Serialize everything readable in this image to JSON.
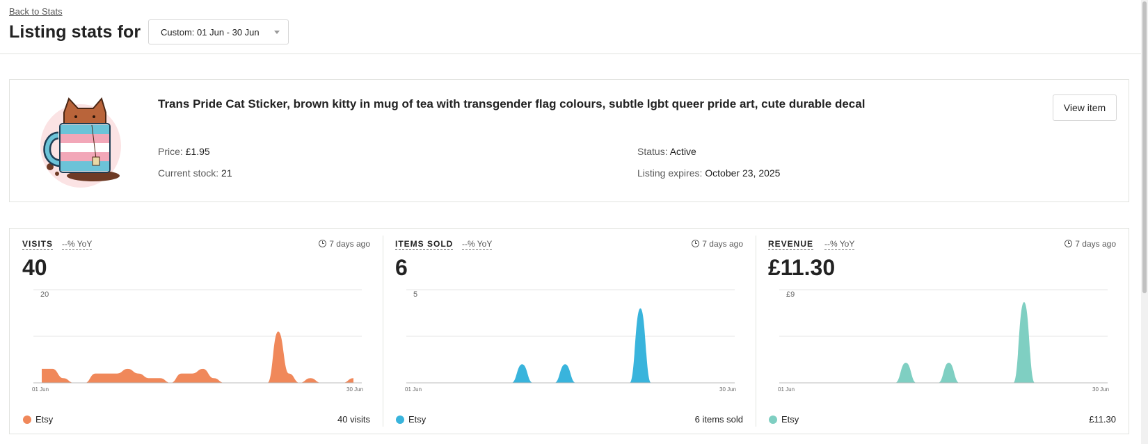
{
  "header": {
    "back_link": "Back to Stats",
    "title": "Listing stats for",
    "date_range": "Custom: 01 Jun - 30 Jun"
  },
  "listing": {
    "title": "Trans Pride Cat Sticker, brown kitty in mug of tea with transgender flag colours, subtle lgbt queer pride art, cute durable decal",
    "view_button": "View item",
    "price_label": "Price:",
    "price": "£1.95",
    "stock_label": "Current stock:",
    "stock": "21",
    "status_label": "Status:",
    "status": "Active",
    "expires_label": "Listing expires:",
    "expires": "October 23, 2025"
  },
  "stats": [
    {
      "label": "VISITS",
      "yoy": "--% YoY",
      "updated": "7 days ago",
      "value": "40",
      "legend": "Etsy",
      "total": "40 visits",
      "color": "#f0885a"
    },
    {
      "label": "ITEMS SOLD",
      "yoy": "--% YoY",
      "updated": "7 days ago",
      "value": "6",
      "legend": "Etsy",
      "total": "6 items sold",
      "color": "#39b4dc"
    },
    {
      "label": "REVENUE",
      "yoy": "--% YoY",
      "updated": "7 days ago",
      "value": "£11.30",
      "legend": "Etsy",
      "total": "£11.30",
      "color": "#7fcfc2"
    }
  ],
  "chart_data": [
    {
      "type": "area",
      "x_start": "01 Jun",
      "x_end": "30 Jun",
      "y_tick": "20",
      "ylim": [
        0,
        20
      ],
      "x": [
        1,
        2,
        3,
        4,
        5,
        6,
        7,
        8,
        9,
        10,
        11,
        12,
        13,
        14,
        15,
        16,
        17,
        18,
        19,
        20,
        21,
        22,
        23,
        24,
        25,
        26,
        27,
        28,
        29,
        30
      ],
      "series": [
        {
          "values": [
            3,
            3,
            1,
            0,
            0,
            2,
            2,
            2,
            3,
            2,
            1,
            1,
            0,
            2,
            2,
            3,
            1,
            0,
            0,
            0,
            0,
            0,
            11,
            2,
            0,
            1,
            0,
            0,
            0,
            1
          ]
        }
      ]
    },
    {
      "type": "area",
      "x_start": "01 Jun",
      "x_end": "30 Jun",
      "y_tick": "5",
      "ylim": [
        0,
        5
      ],
      "x": [
        1,
        2,
        3,
        4,
        5,
        6,
        7,
        8,
        9,
        10,
        11,
        12,
        13,
        14,
        15,
        16,
        17,
        18,
        19,
        20,
        21,
        22,
        23,
        24,
        25,
        26,
        27,
        28,
        29,
        30
      ],
      "series": [
        {
          "values": [
            0,
            0,
            0,
            0,
            0,
            0,
            0,
            0,
            0,
            0,
            1,
            0,
            0,
            0,
            1,
            0,
            0,
            0,
            0,
            0,
            0,
            4,
            0,
            0,
            0,
            0,
            0,
            0,
            0,
            0
          ]
        }
      ]
    },
    {
      "type": "area",
      "x_start": "01 Jun",
      "x_end": "30 Jun",
      "y_tick": "£9",
      "ylim": [
        0,
        9
      ],
      "x": [
        1,
        2,
        3,
        4,
        5,
        6,
        7,
        8,
        9,
        10,
        11,
        12,
        13,
        14,
        15,
        16,
        17,
        18,
        19,
        20,
        21,
        22,
        23,
        24,
        25,
        26,
        27,
        28,
        29,
        30
      ],
      "series": [
        {
          "values": [
            0,
            0,
            0,
            0,
            0,
            0,
            0,
            0,
            0,
            0,
            0,
            1.95,
            0,
            0,
            0,
            1.95,
            0,
            0,
            0,
            0,
            0,
            0,
            7.8,
            0,
            0,
            0,
            0,
            0,
            0,
            0
          ]
        }
      ]
    }
  ]
}
